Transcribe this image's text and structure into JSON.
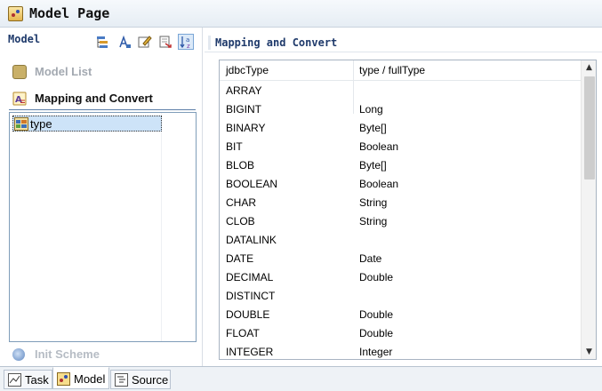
{
  "window": {
    "title": "Model Page",
    "icon": "model-page-icon"
  },
  "left_panel": {
    "title": "Model",
    "toolbar": [
      {
        "name": "tree-properties-icon"
      },
      {
        "name": "text-edit-icon"
      },
      {
        "name": "edit-icon"
      },
      {
        "name": "export-icon"
      },
      {
        "name": "sort-az-icon",
        "selected": true
      }
    ],
    "sections": {
      "model_list": "Model List",
      "mapping": "Mapping and Convert",
      "init_scheme": "Init Scheme"
    },
    "tree": {
      "items": [
        {
          "label": "type",
          "selected": true
        }
      ]
    }
  },
  "right_panel": {
    "title": "Mapping and Convert",
    "columns": [
      "jdbcType",
      "type / fullType"
    ],
    "rows": [
      [
        "ARRAY",
        ""
      ],
      [
        "BIGINT",
        "Long"
      ],
      [
        "BINARY",
        "Byte[]"
      ],
      [
        "BIT",
        "Boolean"
      ],
      [
        "BLOB",
        "Byte[]"
      ],
      [
        "BOOLEAN",
        "Boolean"
      ],
      [
        "CHAR",
        "String"
      ],
      [
        "CLOB",
        "String"
      ],
      [
        "DATALINK",
        ""
      ],
      [
        "DATE",
        "Date"
      ],
      [
        "DECIMAL",
        "Double"
      ],
      [
        "DISTINCT",
        ""
      ],
      [
        "DOUBLE",
        "Double"
      ],
      [
        "FLOAT",
        "Double"
      ],
      [
        "INTEGER",
        "Integer"
      ]
    ],
    "scrollbar": {
      "up": "▲",
      "down": "▼"
    }
  },
  "tabs": [
    {
      "label": "Task",
      "active": false
    },
    {
      "label": "Model",
      "active": true
    },
    {
      "label": "Source",
      "active": false
    }
  ]
}
